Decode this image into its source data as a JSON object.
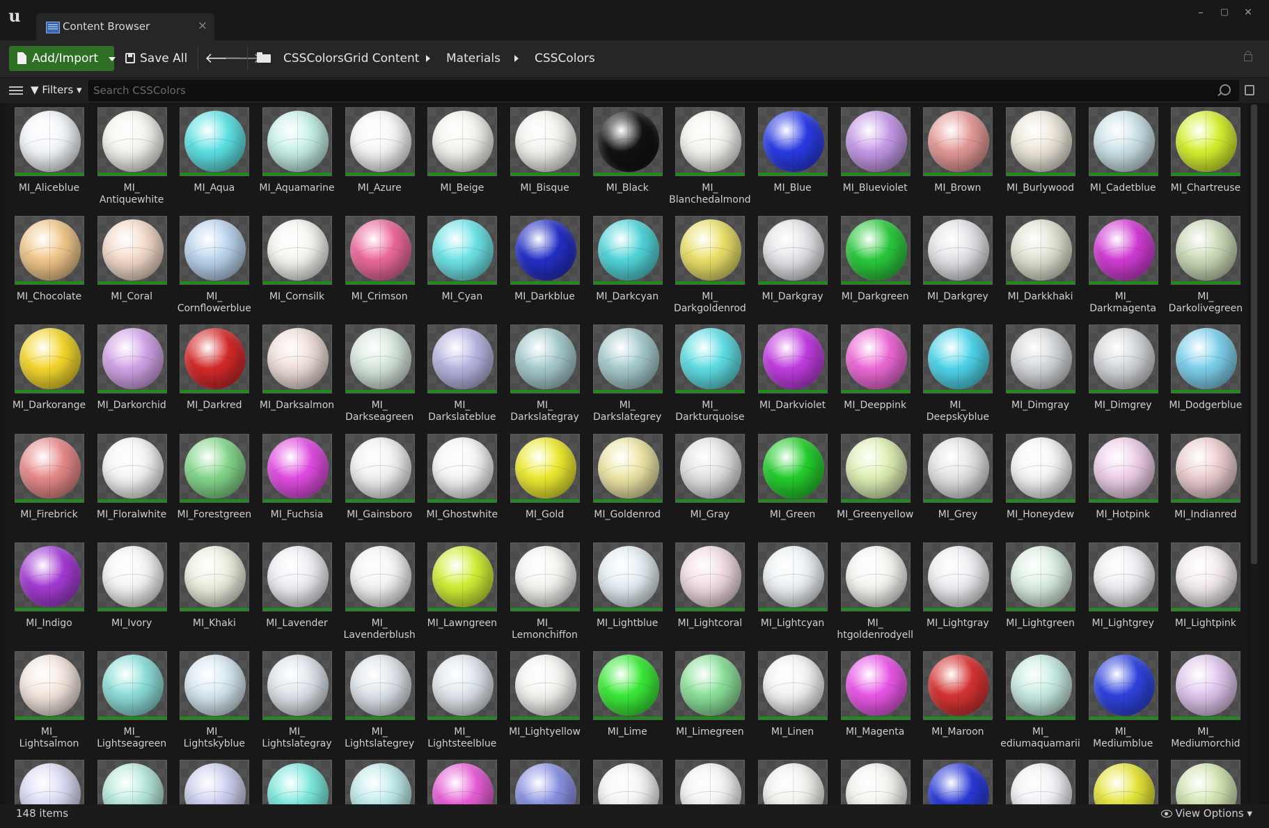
{
  "window": {
    "tab_title": "Content Browser",
    "close_glyph": "×",
    "minimize_glyph": "–",
    "maximize_glyph": "▢",
    "window_close_glyph": "✕",
    "logo": "u"
  },
  "toolbar": {
    "add_label": "Add/Import",
    "save_label": "Save All",
    "back_glyph": "🡐",
    "forward_glyph": "🡒"
  },
  "breadcrumb": [
    "CSSColorsGrid Content",
    "Materials",
    "CSSColors"
  ],
  "filters_label": "Filters",
  "search": {
    "placeholder": "Search CSSColors",
    "value": ""
  },
  "status": {
    "item_count": "148 items",
    "view_options": "View Options"
  },
  "assets": [
    {
      "label": "MI_Aliceblue",
      "color": "#f4f7fb"
    },
    {
      "label": "MI_\nAntiquewhite",
      "color": "#f7f5ef"
    },
    {
      "label": "MI_Aqua",
      "color": "#5fe3e6"
    },
    {
      "label": "MI_Aquamarine",
      "color": "#c8f1ea"
    },
    {
      "label": "MI_Azure",
      "color": "#f6f8f8"
    },
    {
      "label": "MI_Beige",
      "color": "#f4f4ef"
    },
    {
      "label": "MI_Bisque",
      "color": "#f5f3ef"
    },
    {
      "label": "MI_Black",
      "color": "#121212"
    },
    {
      "label": "MI_\nBlanchedalmond",
      "color": "#f6f5f0"
    },
    {
      "label": "MI_Blue",
      "color": "#2b3ce6"
    },
    {
      "label": "MI_Blueviolet",
      "color": "#c89bea"
    },
    {
      "label": "MI_Brown",
      "color": "#e59b98"
    },
    {
      "label": "MI_Burlywood",
      "color": "#eee8db"
    },
    {
      "label": "MI_Cadetblue",
      "color": "#cde4e9"
    },
    {
      "label": "MI_Chartreuse",
      "color": "#d7f230"
    },
    {
      "label": "MI_Chocolate",
      "color": "#f3c98c"
    },
    {
      "label": "MI_Coral",
      "color": "#f5dccb"
    },
    {
      "label": "MI_\nCornflowerblue",
      "color": "#bcd6f0"
    },
    {
      "label": "MI_Cornsilk",
      "color": "#f6f6f2"
    },
    {
      "label": "MI_Crimson",
      "color": "#ee6a9e"
    },
    {
      "label": "MI_Cyan",
      "color": "#6fe6ea"
    },
    {
      "label": "MI_Darkblue",
      "color": "#2430c8"
    },
    {
      "label": "MI_Darkcyan",
      "color": "#52d7dc"
    },
    {
      "label": "MI_\nDarkgoldenrod",
      "color": "#ece26a"
    },
    {
      "label": "MI_Darkgray",
      "color": "#e3e5e8"
    },
    {
      "label": "MI_Darkgreen",
      "color": "#2ccb3e"
    },
    {
      "label": "MI_Darkgrey",
      "color": "#e3e5e8"
    },
    {
      "label": "MI_Darkkhaki",
      "color": "#e1e4d2"
    },
    {
      "label": "MI_\nDarkmagenta",
      "color": "#d43cd6"
    },
    {
      "label": "MI_\nDarkolivegreen",
      "color": "#ccdcb8"
    },
    {
      "label": "MI_Darkorange",
      "color": "#f6d82e"
    },
    {
      "label": "MI_Darkorchid",
      "color": "#d4a5ea"
    },
    {
      "label": "MI_Darkred",
      "color": "#d62a2a"
    },
    {
      "label": "MI_Darksalmon",
      "color": "#f1e0da"
    },
    {
      "label": "MI_\nDarkseagreen",
      "color": "#d8e8dd"
    },
    {
      "label": "MI_\nDarkslateblue",
      "color": "#b9b7e4"
    },
    {
      "label": "MI_\nDarkslategray",
      "color": "#a8cdd0"
    },
    {
      "label": "MI_\nDarkslategrey",
      "color": "#a8cdd0"
    },
    {
      "label": "MI_\nDarkturquoise",
      "color": "#5fdfe6"
    },
    {
      "label": "MI_Darkviolet",
      "color": "#c23de2"
    },
    {
      "label": "MI_Deeppink",
      "color": "#ef6ad8"
    },
    {
      "label": "MI_\nDeepskyblue",
      "color": "#4fd7ec"
    },
    {
      "label": "MI_Dimgray",
      "color": "#d5d8db"
    },
    {
      "label": "MI_Dimgrey",
      "color": "#d5d8db"
    },
    {
      "label": "MI_Dodgerblue",
      "color": "#7fd2ef"
    },
    {
      "label": "MI_Firebrick",
      "color": "#ea8b8b"
    },
    {
      "label": "MI_Floralwhite",
      "color": "#f6f6f4"
    },
    {
      "label": "MI_Forestgreen",
      "color": "#86d98d"
    },
    {
      "label": "MI_Fuchsia",
      "color": "#e34de4"
    },
    {
      "label": "MI_Gainsboro",
      "color": "#f2f3f3"
    },
    {
      "label": "MI_Ghostwhite",
      "color": "#f6f7f8"
    },
    {
      "label": "MI_Gold",
      "color": "#efec32"
    },
    {
      "label": "MI_Goldenrod",
      "color": "#efe7a8"
    },
    {
      "label": "MI_Gray",
      "color": "#e2e4e6"
    },
    {
      "label": "MI_Green",
      "color": "#25cf2e"
    },
    {
      "label": "MI_Greenyellow",
      "color": "#dff1b5"
    },
    {
      "label": "MI_Grey",
      "color": "#e2e4e6"
    },
    {
      "label": "MI_Honeydew",
      "color": "#f5f7f6"
    },
    {
      "label": "MI_Hotpink",
      "color": "#f0d0ea"
    },
    {
      "label": "MI_Indianred",
      "color": "#efcfd2"
    },
    {
      "label": "MI_Indigo",
      "color": "#a63cd6"
    },
    {
      "label": "MI_Ivory",
      "color": "#f6f6f4"
    },
    {
      "label": "MI_Khaki",
      "color": "#eef0e0"
    },
    {
      "label": "MI_Lavender",
      "color": "#eef0f5"
    },
    {
      "label": "MI_\nLavenderblush",
      "color": "#f6f5f6"
    },
    {
      "label": "MI_Lawngreen",
      "color": "#d2f036"
    },
    {
      "label": "MI_\nLemonchiffon",
      "color": "#f5f6f2"
    },
    {
      "label": "MI_Lightblue",
      "color": "#e5eff4"
    },
    {
      "label": "MI_Lightcoral",
      "color": "#f3dde2"
    },
    {
      "label": "MI_Lightcyan",
      "color": "#eef4f6"
    },
    {
      "label": "MI_\nhtgoldenrodyell",
      "color": "#f6f6f3"
    },
    {
      "label": "MI_Lightgray",
      "color": "#eef0f3"
    },
    {
      "label": "MI_Lightgreen",
      "color": "#dcf0e2"
    },
    {
      "label": "MI_Lightgrey",
      "color": "#eef0f3"
    },
    {
      "label": "MI_Lightpink",
      "color": "#f4ecf0"
    },
    {
      "label": "MI_\nLightsalmon",
      "color": "#f5e8e0"
    },
    {
      "label": "MI_\nLightseagreen",
      "color": "#8ee0dc"
    },
    {
      "label": "MI_\nLightskyblue",
      "color": "#d8e9f2"
    },
    {
      "label": "MI_\nLightslategray",
      "color": "#dfe6ec"
    },
    {
      "label": "MI_\nLightslategrey",
      "color": "#dfe6ec"
    },
    {
      "label": "MI_\nLightsteelblue",
      "color": "#e1e8ee"
    },
    {
      "label": "MI_Lightyellow",
      "color": "#f5f5f2"
    },
    {
      "label": "MI_Lime",
      "color": "#3cec3a"
    },
    {
      "label": "MI_Limegreen",
      "color": "#8ee39c"
    },
    {
      "label": "MI_Linen",
      "color": "#f3f5f6"
    },
    {
      "label": "MI_Magenta",
      "color": "#ec58ea"
    },
    {
      "label": "MI_Maroon",
      "color": "#d83434"
    },
    {
      "label": "MI_\nediumaquamarii",
      "color": "#c7ece3"
    },
    {
      "label": "MI_\nMediumblue",
      "color": "#2f44e0"
    },
    {
      "label": "MI_\nMediumorchid",
      "color": "#e2c8f0"
    },
    {
      "label": "",
      "color": "#dcdcf6"
    },
    {
      "label": "",
      "color": "#b8eadd"
    },
    {
      "label": "",
      "color": "#cdd0f0"
    },
    {
      "label": "",
      "color": "#7deadf"
    },
    {
      "label": "",
      "color": "#c0ecec"
    },
    {
      "label": "",
      "color": "#ea5ed8"
    },
    {
      "label": "",
      "color": "#8a93e4"
    },
    {
      "label": "",
      "color": "#f4f5f6"
    },
    {
      "label": "",
      "color": "#f4f4f2"
    },
    {
      "label": "",
      "color": "#f2f3ef"
    },
    {
      "label": "",
      "color": "#f4f4f0"
    },
    {
      "label": "",
      "color": "#2a3ad8"
    },
    {
      "label": "",
      "color": "#f1f3f6"
    },
    {
      "label": "",
      "color": "#e6e63a"
    },
    {
      "label": "",
      "color": "#d3e6b2"
    }
  ]
}
